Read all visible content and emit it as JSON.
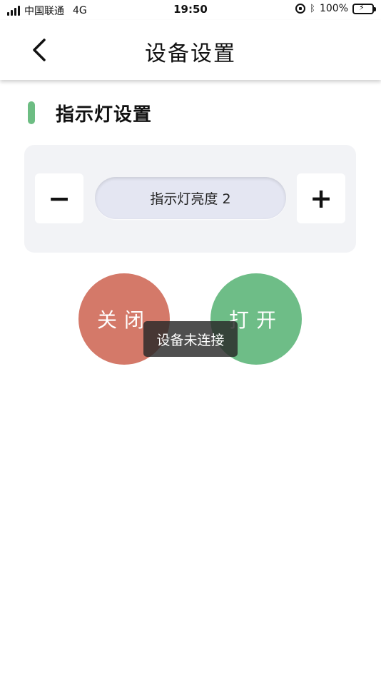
{
  "status_bar": {
    "carrier": "中国联通",
    "network": "4G",
    "time": "19:50",
    "battery": "100%",
    "icons": [
      "signal-icon",
      "rotation-lock-icon",
      "bluetooth-icon",
      "battery-charging-icon"
    ]
  },
  "header": {
    "title": "设备设置",
    "back_icon": "chevron-left-icon"
  },
  "section": {
    "title": "指示灯设置",
    "accent_color": "#6dbd83"
  },
  "brightness": {
    "minus_label": "−",
    "plus_label": "+",
    "label": "指示灯亮度 2"
  },
  "buttons": {
    "off_label": "关闭",
    "on_label": "打开",
    "off_color": "#d47969",
    "on_color": "#6ebd87"
  },
  "toast": {
    "message": "设备未连接"
  }
}
